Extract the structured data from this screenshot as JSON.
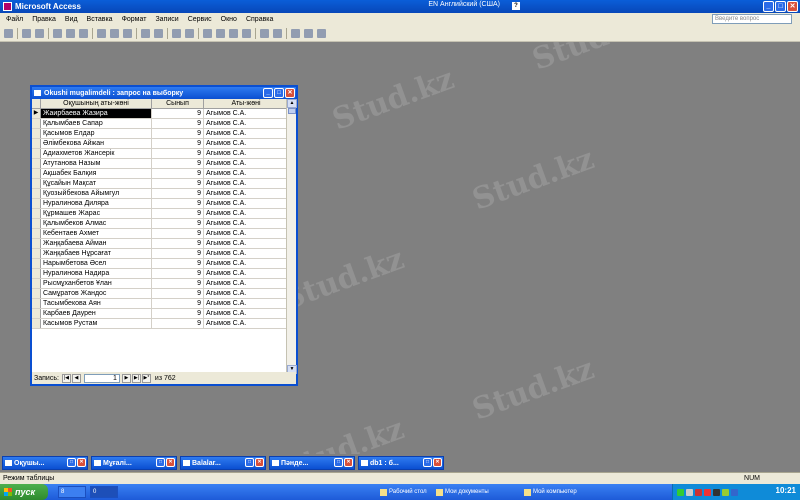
{
  "app": {
    "title": "Microsoft Access",
    "lang": "EN Английский (США)",
    "help_placeholder": "Введите вопрос"
  },
  "menu": [
    "Файл",
    "Правка",
    "Вид",
    "Вставка",
    "Формат",
    "Записи",
    "Сервис",
    "Окно",
    "Справка"
  ],
  "query_window": {
    "title": "Okushi mugalimdeli : запрос на выборку",
    "columns": [
      "Оқушының аты-жөні",
      "Сынып",
      "Аты-жөні"
    ],
    "rows": [
      {
        "name": "Жаирбаева Жазира",
        "class": "9",
        "teacher": "Агымов С.А."
      },
      {
        "name": "Қалымбаев Сапар",
        "class": "9",
        "teacher": "Агымов С.А."
      },
      {
        "name": "Қасымов Елдар",
        "class": "9",
        "teacher": "Агымов С.А."
      },
      {
        "name": "Әлімбекова Айжан",
        "class": "9",
        "teacher": "Агымов С.А."
      },
      {
        "name": "Адиахметов Жансерік",
        "class": "9",
        "teacher": "Агымов С.А."
      },
      {
        "name": "Атутанова Назым",
        "class": "9",
        "teacher": "Агымов С.А."
      },
      {
        "name": "Ақшабек Балқия",
        "class": "9",
        "teacher": "Агымов С.А."
      },
      {
        "name": "Құсайын Мақсат",
        "class": "9",
        "teacher": "Агымов С.А."
      },
      {
        "name": "Қуозыйбекова Айымгул",
        "class": "9",
        "teacher": "Агымов С.А."
      },
      {
        "name": "Нуралинова Диляра",
        "class": "9",
        "teacher": "Агымов С.А."
      },
      {
        "name": "Құрмашев Жарас",
        "class": "9",
        "teacher": "Агымов С.А."
      },
      {
        "name": "Қалымбеков Алмас",
        "class": "9",
        "teacher": "Агымов С.А."
      },
      {
        "name": "Кебентаев Ахмет",
        "class": "9",
        "teacher": "Агымов С.А."
      },
      {
        "name": "Жаңқабаева Айман",
        "class": "9",
        "teacher": "Агымов С.А."
      },
      {
        "name": "Жаңқабаев Нұрсағат",
        "class": "9",
        "teacher": "Агымов С.А."
      },
      {
        "name": "Нарымбетова Әсел",
        "class": "9",
        "teacher": "Агымов С.А."
      },
      {
        "name": "Нуралинова Надира",
        "class": "9",
        "teacher": "Агымов С.А."
      },
      {
        "name": "Рысмұханбетов Ұлан",
        "class": "9",
        "teacher": "Агымов С.А."
      },
      {
        "name": "Самұратов Жандос",
        "class": "9",
        "teacher": "Агымов С.А."
      },
      {
        "name": "Тасымбекова Аян",
        "class": "9",
        "teacher": "Агымов С.А."
      },
      {
        "name": "Карбаев Даурен",
        "class": "9",
        "teacher": "Агымов С.А."
      },
      {
        "name": "Касымов Рустам",
        "class": "9",
        "teacher": "Агымов С.А."
      }
    ],
    "nav": {
      "label": "Запись:",
      "current": "1",
      "of": "из 762"
    }
  },
  "minimized": [
    "Оқушы...",
    "Мұғалі...",
    "Balalar...",
    "Пәнде...",
    "db1 : б..."
  ],
  "status": {
    "mode": "Режим таблицы",
    "num": "NUM"
  },
  "taskbar": {
    "start": "пуск",
    "tasks": [
      "8",
      "0"
    ],
    "links": [
      "Рабочий стол",
      "Мои документы",
      "Мой компьютер"
    ],
    "clock": "10:21"
  },
  "watermark": "Stud.kz"
}
